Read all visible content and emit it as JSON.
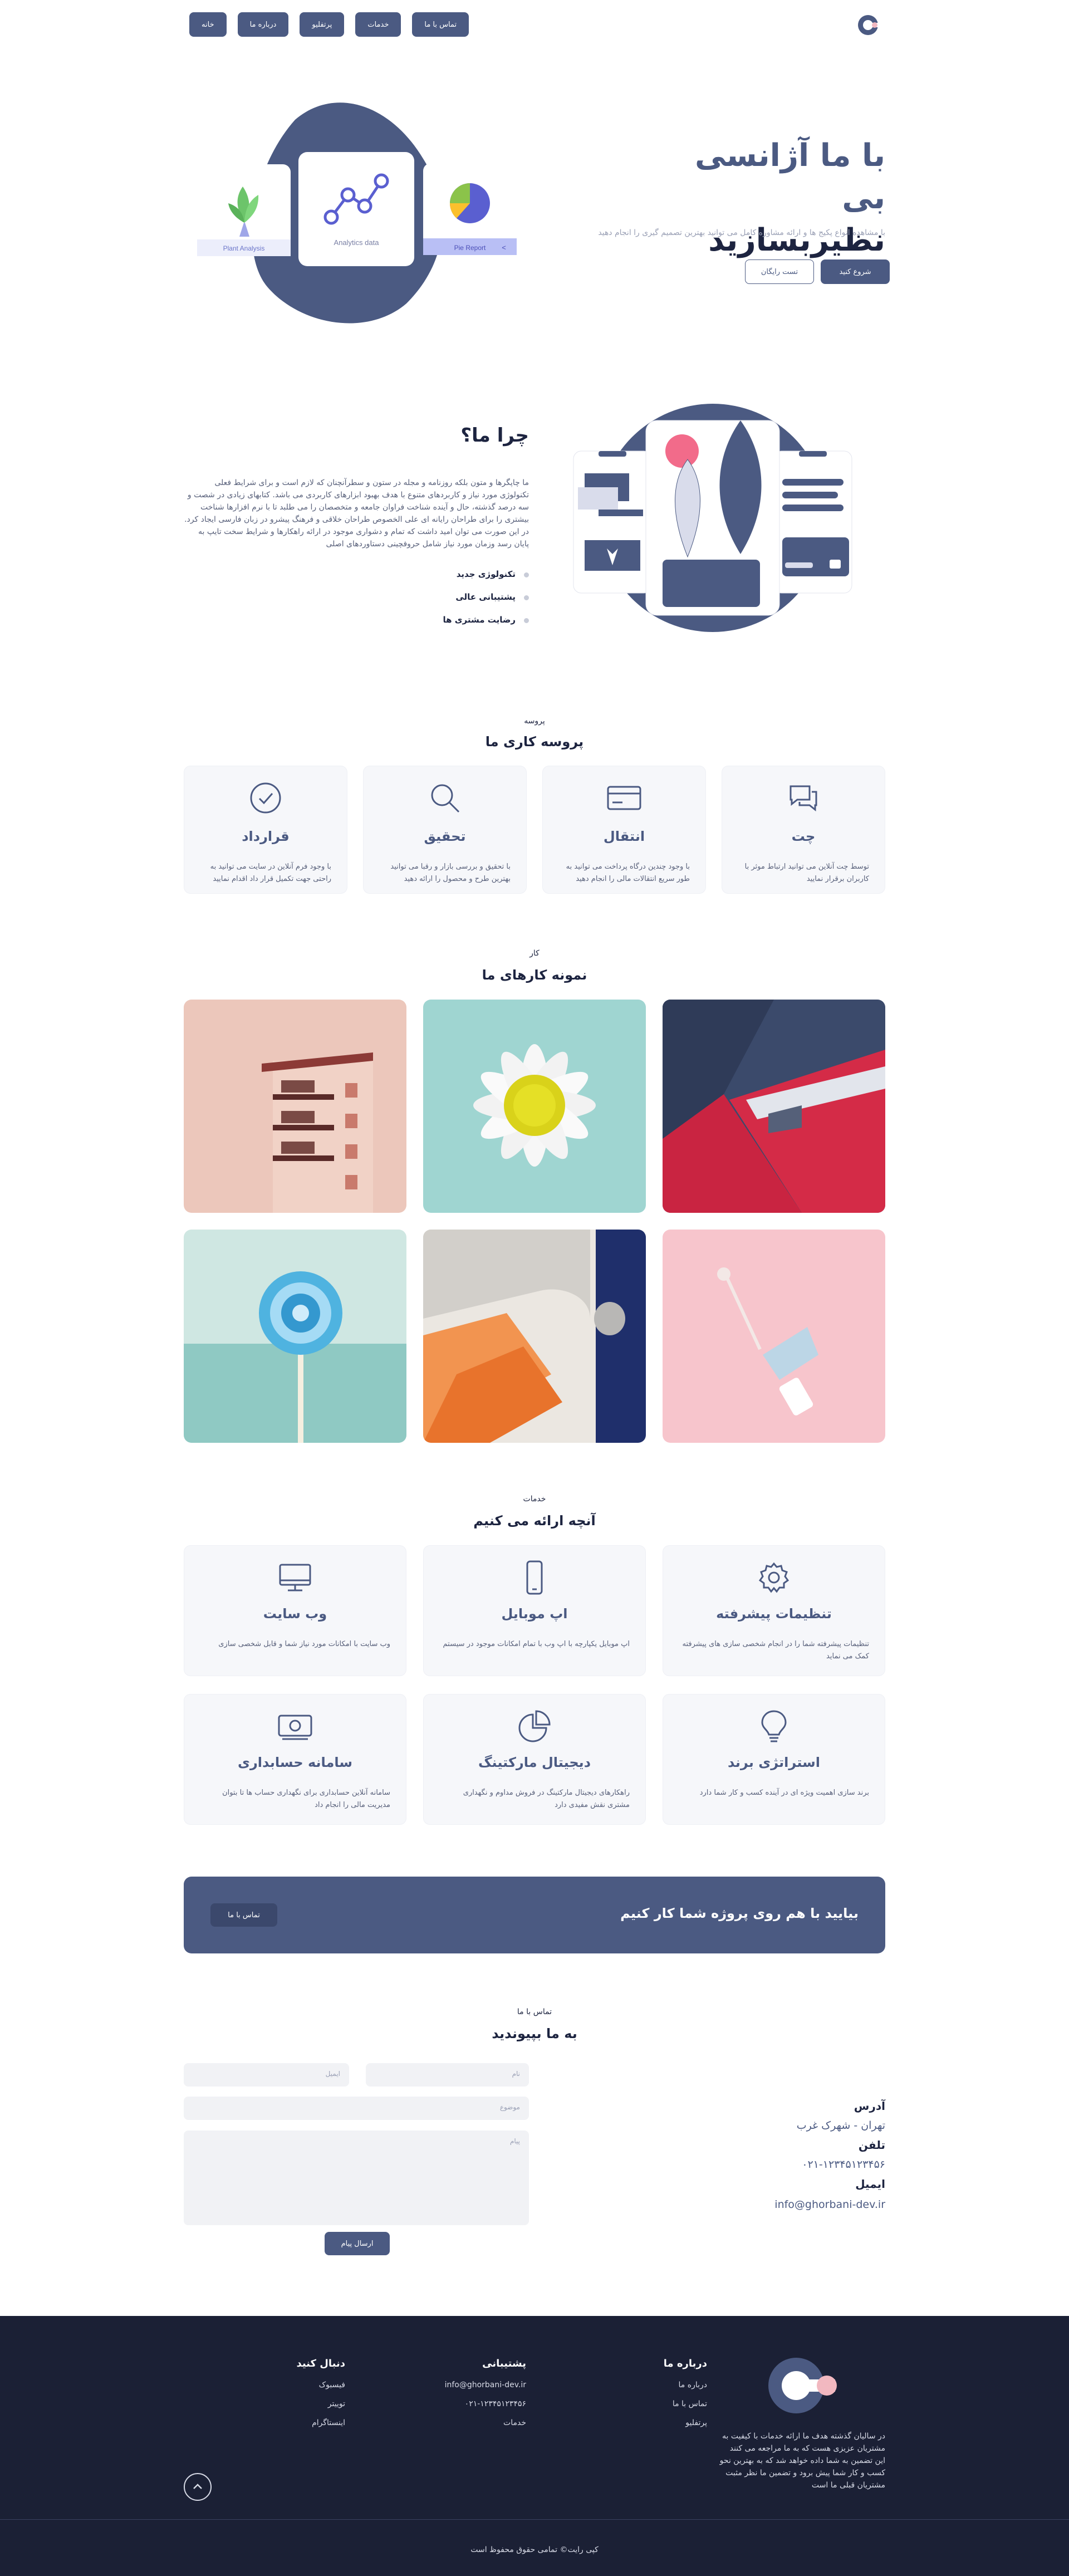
{
  "nav": {
    "items": [
      {
        "label": "خانه"
      },
      {
        "label": "درباره ما"
      },
      {
        "label": "پرتفلیو"
      },
      {
        "label": "خدمات"
      },
      {
        "label": "تماس با ما"
      }
    ]
  },
  "hero": {
    "title_accent_1": "با ما",
    "title_accent_2": "آژانسی بی",
    "title_line_2": "نظیربسازید",
    "subtitle": "با مشاهده انواع پکیج ها و ارائه مشاوره کامل می توانید بهترین تصمیم گیری را انجام دهید",
    "primary_button": "شروع کنید",
    "secondary_button": "تست رایگان",
    "cards": {
      "plant": "Plant Analysis",
      "analytics": "Analytics data",
      "report": "Pie Report",
      "report_arrow": ">"
    }
  },
  "why": {
    "title": "چرا ما؟",
    "paragraph": "ما چاپگرها و متون بلکه روزنامه و مجله در ستون و سطرآنچنان که لازم است و برای شرایط فعلی تکنولوژی مورد نیاز و کاربردهای متنوع با هدف بهبود ابزارهای کاربردی می باشد. کتابهای زیادی در شصت و سه درصد گذشته، حال و آینده شناخت فراوان جامعه و متخصصان را می طلبد تا با نرم افزارها شناخت بیشتری را برای طراحان رایانه ای علی الخصوص طراحان خلاقی و فرهنگ پیشرو در زبان فارسی ایجاد کرد. در این صورت می توان امید داشت که تمام و دشواری موجود در ارائه راهکارها و شرایط سخت تایپ به پایان رسد وزمان مورد نیاز شامل حروفچینی دستاوردهای اصلی",
    "list": [
      "تکنولوژی جدید",
      "پشتیبانی عالی",
      "رضایت مشتری ها"
    ]
  },
  "process": {
    "subtitle": "پروسه",
    "title": "پروسه کاری ما",
    "cards": [
      {
        "icon": "chat-icon",
        "title": "چت",
        "text": "توسط چت آنلاین می توانید ارتباط موثر با کاربران برقرار نمایید"
      },
      {
        "icon": "credit-card-icon",
        "title": "انتقال",
        "text": "با وجود چندین درگاه پرداخت می توانید به طور سریع انتقالات مالی را انجام دهید"
      },
      {
        "icon": "search-icon",
        "title": "تحقیق",
        "text": "با تحقیق و بررسی بازار و رقبا می توانید بهترین طرح و محصول را ارائه دهید"
      },
      {
        "icon": "check-circle-icon",
        "title": "قرارداد",
        "text": "با وجود فرم آنلاین در سایت می توانید به راحتی جهت تکمیل قرار داد اقدام نمایید"
      }
    ]
  },
  "portfolio": {
    "subtitle": "کار",
    "title": "نمونه کارهای ما",
    "items": [
      {
        "name": "red-architecture"
      },
      {
        "name": "daisy-flower"
      },
      {
        "name": "pink-building"
      },
      {
        "name": "nail-polish"
      },
      {
        "name": "abstract-shapes"
      },
      {
        "name": "lollipop"
      }
    ]
  },
  "services": {
    "subtitle": "خدمات",
    "title": "آنچه ارائه می کنیم",
    "cards": [
      {
        "icon": "gear-icon",
        "title": "تنظیمات پیشرفته",
        "text": "تنظیمات پیشرفته شما را در انجام شخصی سازی های پیشرفته کمک می نماید"
      },
      {
        "icon": "mobile-icon",
        "title": "اپ موبایل",
        "text": "اپ موبایل یکپارچه با اپ وب با تمام امکانات موجود در سیستم"
      },
      {
        "icon": "monitor-icon",
        "title": "وب سایت",
        "text": "وب سایت با امکانات مورد نیاز شما و قابل شخصی سازی"
      },
      {
        "icon": "lightbulb-icon",
        "title": "استراتژی برند",
        "text": "برند سازی اهمیت ویژه ای در آینده کسب و کار شما دارد"
      },
      {
        "icon": "pie-chart-icon",
        "title": "دیجیتال مارکتینگ",
        "text": "راهکارهای دیجیتال مارکتینگ در فروش مداوم و نگهداری مشتری نقش مفیدی دارد"
      },
      {
        "icon": "cash-icon",
        "title": "سامانه حسابداری",
        "text": "سامانه آنلاین حسابداری برای نگهداری حساب ها تا بتوان مدیریت مالی را انجام داد"
      }
    ]
  },
  "cta": {
    "text": "بیایید با هم روی پروژه شما کار کنیم",
    "button": "تماس با ما"
  },
  "contact": {
    "subtitle": "تماس با ما",
    "title": "به ما بپیوندید",
    "name_placeholder": "نام",
    "email_placeholder": "ایمیل",
    "subject_placeholder": "موضوع",
    "message_placeholder": "پیام",
    "submit": "ارسال پیام",
    "address_label": "آدرس",
    "address_value": "تهران - شهرک غرب",
    "phone_label": "تلفن",
    "phone_value": "۰۲۱-۱۲۳۴۵۱۲۳۴۵۶",
    "email_label": "ایمیل",
    "email_value": "info@ghorbani-dev.ir"
  },
  "footer": {
    "about_text": "در سالیان گذشته هدف ما ارائه خدمات با کیفیت به مشتریان عزیزی هست که به ما مراجعه می کنند این تضمین به شما داده خواهد شد که به بهترین نحو کسب و کار شما پیش برود و تضمین ما نظر مثبت مشتریان قبلی ما است",
    "col_about": {
      "title": "درباره ما",
      "links": [
        "درباره ما",
        "تماس با ما",
        "پرتفلیو"
      ]
    },
    "col_support": {
      "title": "پشتیبانی",
      "links": [
        "info@ghorbani-dev.ir",
        "۰۲۱-۱۲۳۴۵۱۲۳۴۵۶",
        "خدمات"
      ]
    },
    "col_follow": {
      "title": "دنبال کنید",
      "links": [
        "فیسبوک",
        "توییتر",
        "اینستاگرام"
      ]
    },
    "copyright": "کپی رایت© تمامی حقوق محفوظ است"
  },
  "colors": {
    "primary": "#4b5a82",
    "dark": "#1d2440",
    "footer_bg": "#1b2035",
    "card_bg": "#f6f7fa"
  }
}
